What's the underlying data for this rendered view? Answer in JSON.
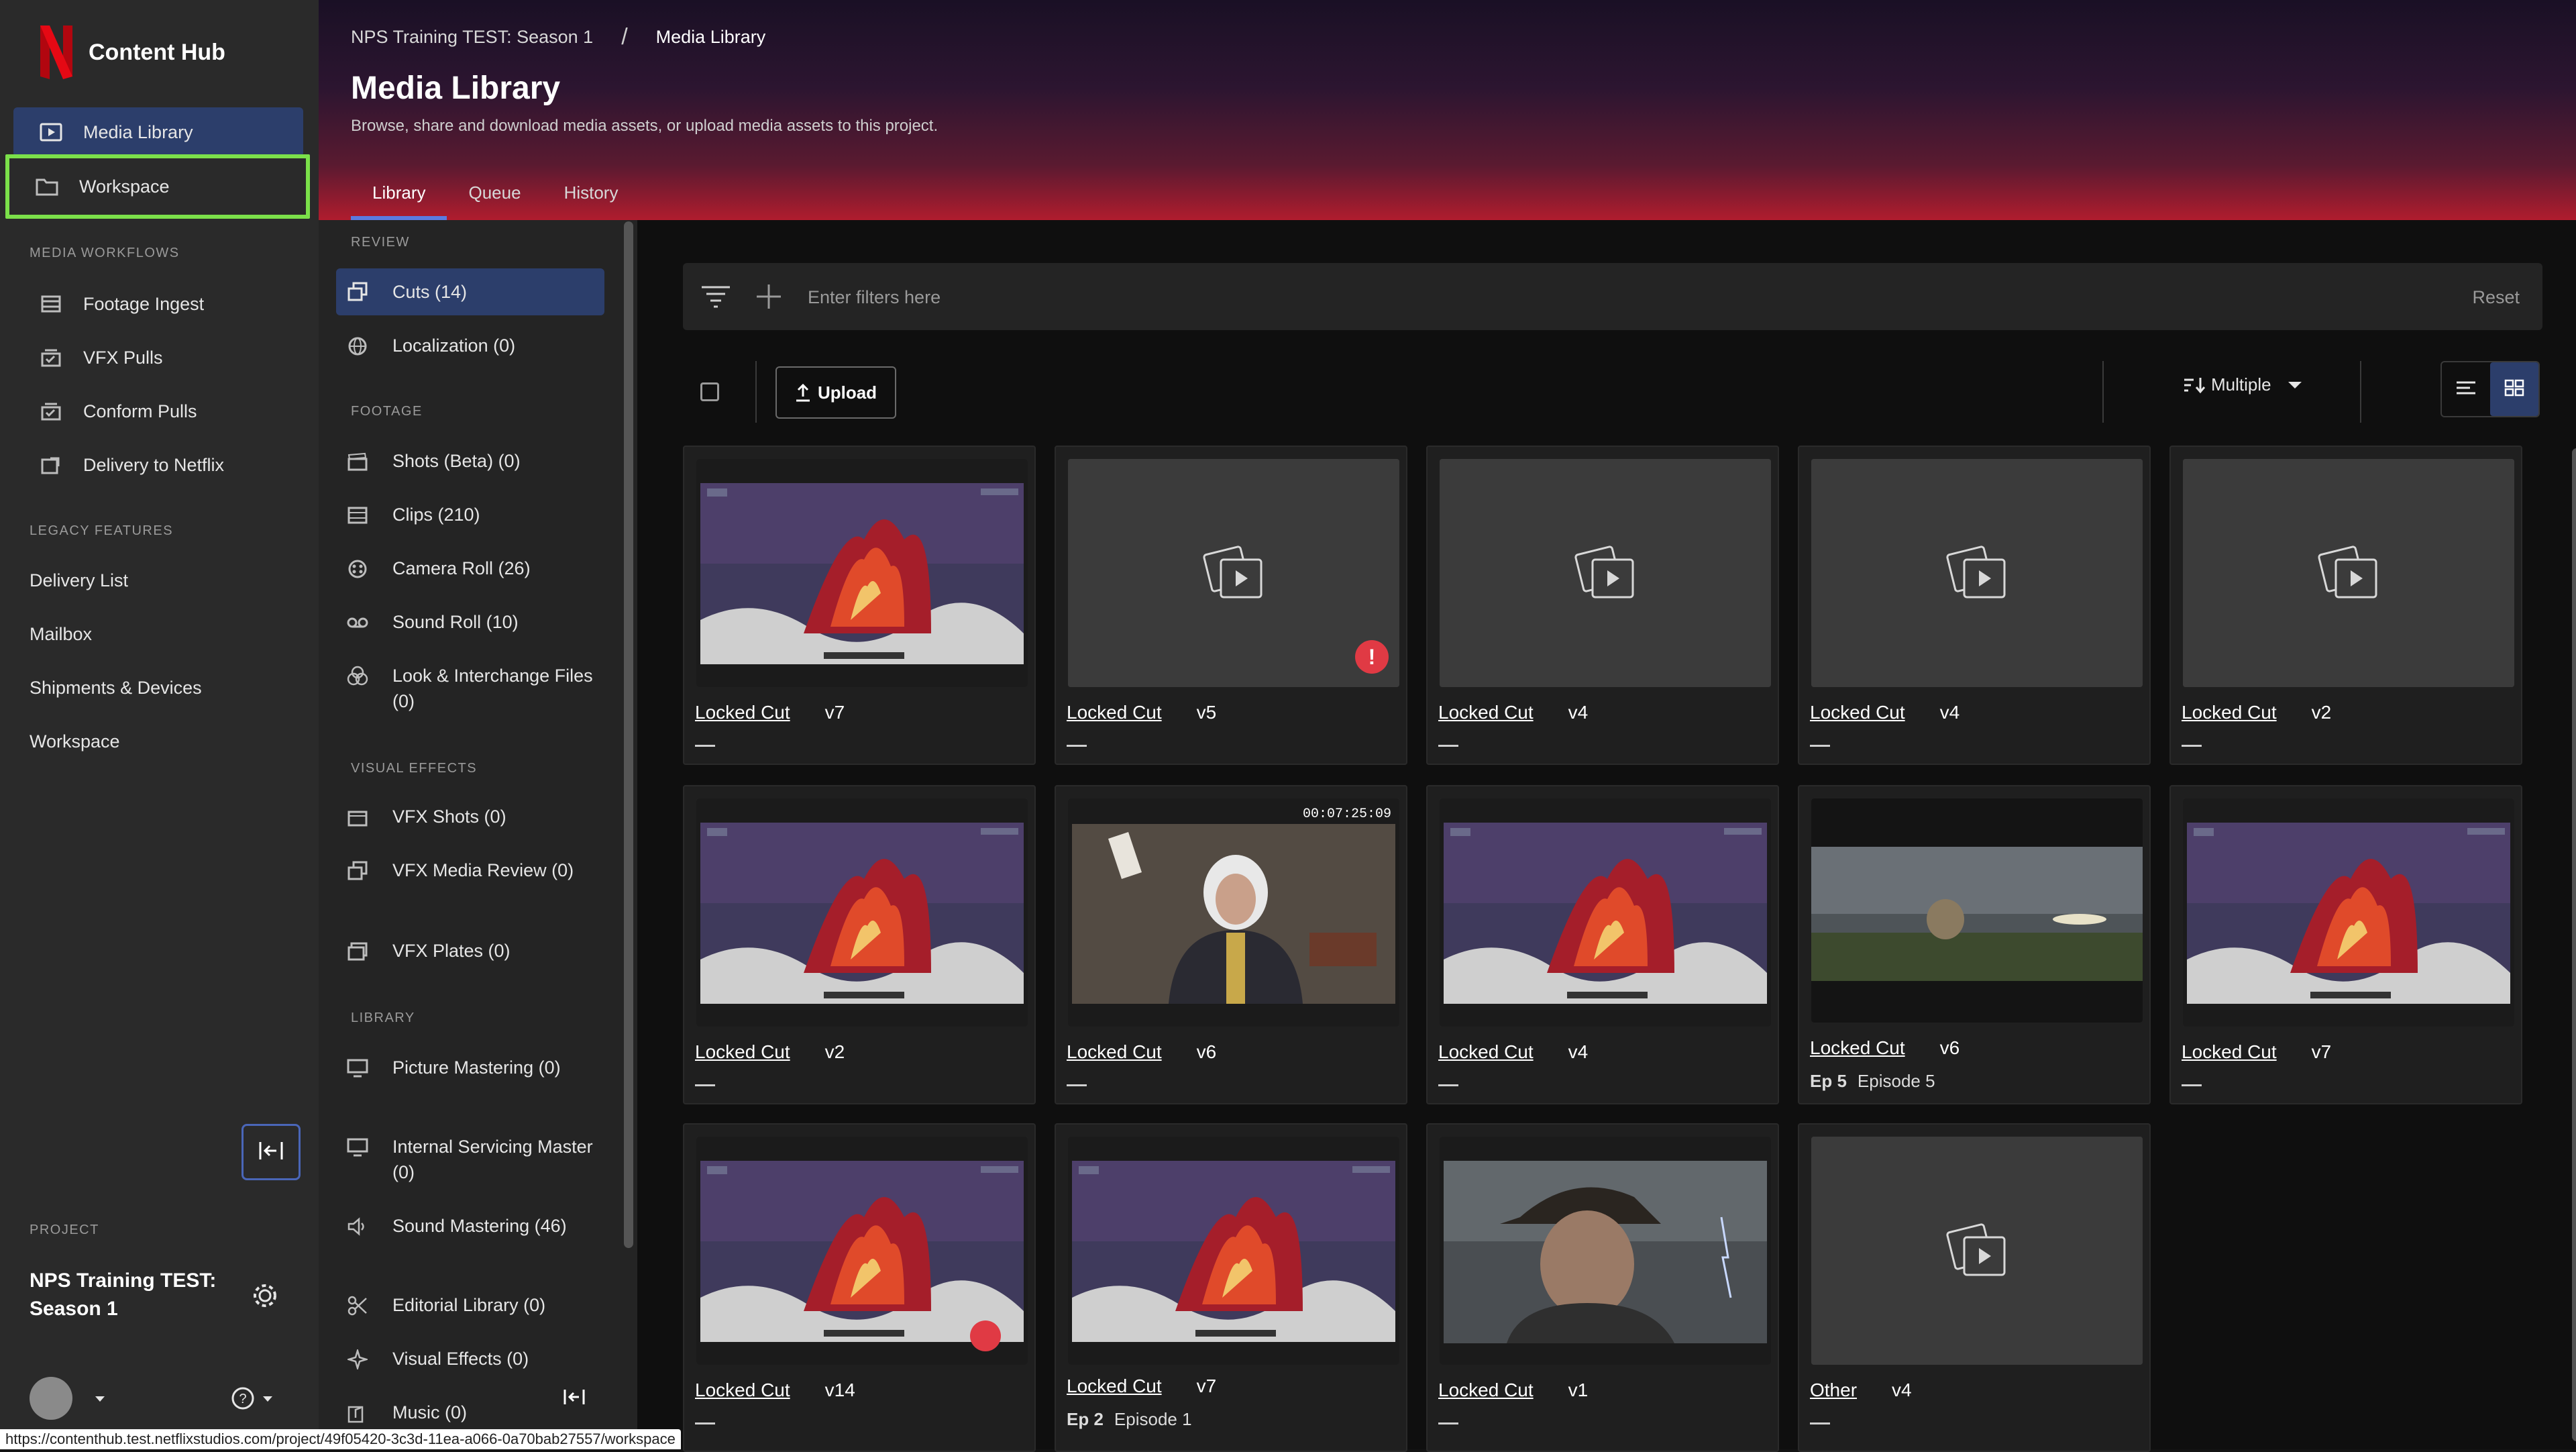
{
  "app": {
    "brand_name": "Content Hub",
    "accent": "#2c3e6b",
    "logo_color": "#e50914"
  },
  "leftnav": {
    "primary": [
      {
        "label": "Media Library",
        "icon": "media-library-icon",
        "active": true
      },
      {
        "label": "Workspace",
        "icon": "folder-icon",
        "highlighted": true
      }
    ],
    "media_workflows_label": "MEDIA WORKFLOWS",
    "media_workflows": [
      {
        "label": "Footage Ingest",
        "icon": "footage-ingest-icon"
      },
      {
        "label": "VFX Pulls",
        "icon": "vfx-pulls-icon"
      },
      {
        "label": "Conform Pulls",
        "icon": "conform-pulls-icon"
      },
      {
        "label": "Delivery to Netflix",
        "icon": "delivery-icon"
      }
    ],
    "legacy_label": "LEGACY FEATURES",
    "legacy": [
      "Delivery List",
      "Mailbox",
      "Shipments & Devices",
      "Workspace"
    ],
    "project_label": "PROJECT",
    "project_name": "NPS Training TEST: Season 1"
  },
  "header": {
    "breadcrumb": [
      "NPS Training TEST: Season 1",
      "Media Library"
    ],
    "breadcrumb_sep": "/",
    "title": "Media Library",
    "subtitle": "Browse, share and download media assets, or upload media assets to this project.",
    "tabs": [
      {
        "label": "Library",
        "active": true
      },
      {
        "label": "Queue"
      },
      {
        "label": "History"
      }
    ]
  },
  "subnav": {
    "review_label": "REVIEW",
    "review": [
      {
        "label": "Cuts (14)",
        "active": true
      },
      {
        "label": "Localization (0)"
      }
    ],
    "footage_label": "FOOTAGE",
    "footage": [
      {
        "label": "Shots (Beta) (0)"
      },
      {
        "label": "Clips (210)"
      },
      {
        "label": "Camera Roll (26)"
      },
      {
        "label": "Sound Roll (10)"
      },
      {
        "label": "Look & Interchange Files (0)"
      }
    ],
    "vfx_label": "VISUAL EFFECTS",
    "vfx": [
      {
        "label": "VFX Shots (0)"
      },
      {
        "label": "VFX Media Review (0)"
      },
      {
        "label": "VFX Plates (0)"
      }
    ],
    "library_label": "LIBRARY",
    "library": [
      {
        "label": "Picture Mastering (0)"
      },
      {
        "label": "Internal Servicing Master (0)"
      },
      {
        "label": "Sound Mastering (46)"
      },
      {
        "label": "Editorial Library (0)"
      },
      {
        "label": "Visual Effects (0)"
      },
      {
        "label": "Music (0)"
      }
    ]
  },
  "main": {
    "filter_placeholder": "Enter filters here",
    "reset_label": "Reset",
    "upload_label": "Upload",
    "sort_label": "Multiple",
    "cards": [
      {
        "title": "Locked Cut",
        "version": "v7",
        "thumb": "fire"
      },
      {
        "title": "Locked Cut",
        "version": "v5",
        "thumb": "placeholder",
        "error": true
      },
      {
        "title": "Locked Cut",
        "version": "v4",
        "thumb": "placeholder"
      },
      {
        "title": "Locked Cut",
        "version": "v4",
        "thumb": "placeholder"
      },
      {
        "title": "Locked Cut",
        "version": "v2",
        "thumb": "placeholder"
      },
      {
        "title": "Locked Cut",
        "version": "v2",
        "thumb": "fire"
      },
      {
        "title": "Locked Cut",
        "version": "v6",
        "thumb": "interview",
        "timecode": "00:07:25:09"
      },
      {
        "title": "Locked Cut",
        "version": "v4",
        "thumb": "fire"
      },
      {
        "title": "Locked Cut",
        "version": "v6",
        "thumb": "landscape",
        "ep": "Ep 5",
        "episode": "Episode 5"
      },
      {
        "title": "Locked Cut",
        "version": "v7",
        "thumb": "fire"
      },
      {
        "title": "Locked Cut",
        "version": "v14",
        "thumb": "fire",
        "error_small": true
      },
      {
        "title": "Locked Cut",
        "version": "v7",
        "thumb": "fire",
        "ep": "Ep 2",
        "episode": "Episode 1"
      },
      {
        "title": "Locked Cut",
        "version": "v1",
        "thumb": "man"
      },
      {
        "title": "Other",
        "version": "v4",
        "thumb": "placeholder"
      }
    ],
    "error_glyph": "!"
  },
  "status_url": "https://contenthub.test.netflixstudios.com/project/49f05420-3c3d-11ea-a066-0a70bab27557/workspace"
}
